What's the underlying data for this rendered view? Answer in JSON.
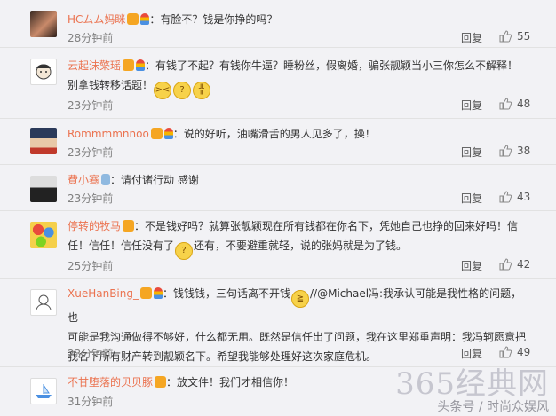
{
  "comments": [
    {
      "username": "HCムム妈眯",
      "text": "：有脸不？钱是你挣的吗？",
      "time": "28分钟前",
      "reply": "回复",
      "likes": "55"
    },
    {
      "username": "云起沫檠瑶",
      "text_1": "：有钱了不起？有钱你牛逼？睡粉丝，假离婚，骗张靓颖当小三你怎么不解释！",
      "text_2": "别拿钱转移话题！",
      "time": "23分钟前",
      "reply": "回复",
      "likes": "48"
    },
    {
      "username": "Rommmmnnoo",
      "text": "：说的好听，油嘴滑舌的男人见多了，操！",
      "time": "23分钟前",
      "reply": "回复",
      "likes": "38"
    },
    {
      "username": "費小骞",
      "text": "：请付诸行动 感谢",
      "time": "23分钟前",
      "reply": "回复",
      "likes": "43"
    },
    {
      "username": "停转的牧马",
      "text_1": "：不是钱好吗？就算张靓颖现在所有钱都在你名下，凭她自己也挣的回来好吗！信",
      "text_2a": "任！信任！信任没有了",
      "text_2b": "还有，不要避重就轻，说的张妈就是为了钱。",
      "time": "25分钟前",
      "reply": "回复",
      "likes": "42"
    },
    {
      "username": "XueHanBing_",
      "text_1a": "：钱钱钱，三句话离不开钱",
      "text_1b": "//@Michael冯:我承认可能是我性格的问题，也",
      "text_2": "可能是我沟通做得不够好，什么都无用。既然是信任出了问题，我在这里郑重声明：我冯轲愿意把",
      "text_3": "我名下所有财产转到靓颖名下。希望我能够处理好这次家庭危机。",
      "time": "23分钟前",
      "reply": "回复",
      "likes": "49"
    },
    {
      "username": "不甘堕落的贝贝豚",
      "text": "：放文件！我们才相信你！",
      "time": "31分钟前",
      "reply": "回复",
      "likes": ""
    }
  ],
  "watermark": {
    "big": "365经典网",
    "small": "头条号 / 时尚众娱风"
  }
}
